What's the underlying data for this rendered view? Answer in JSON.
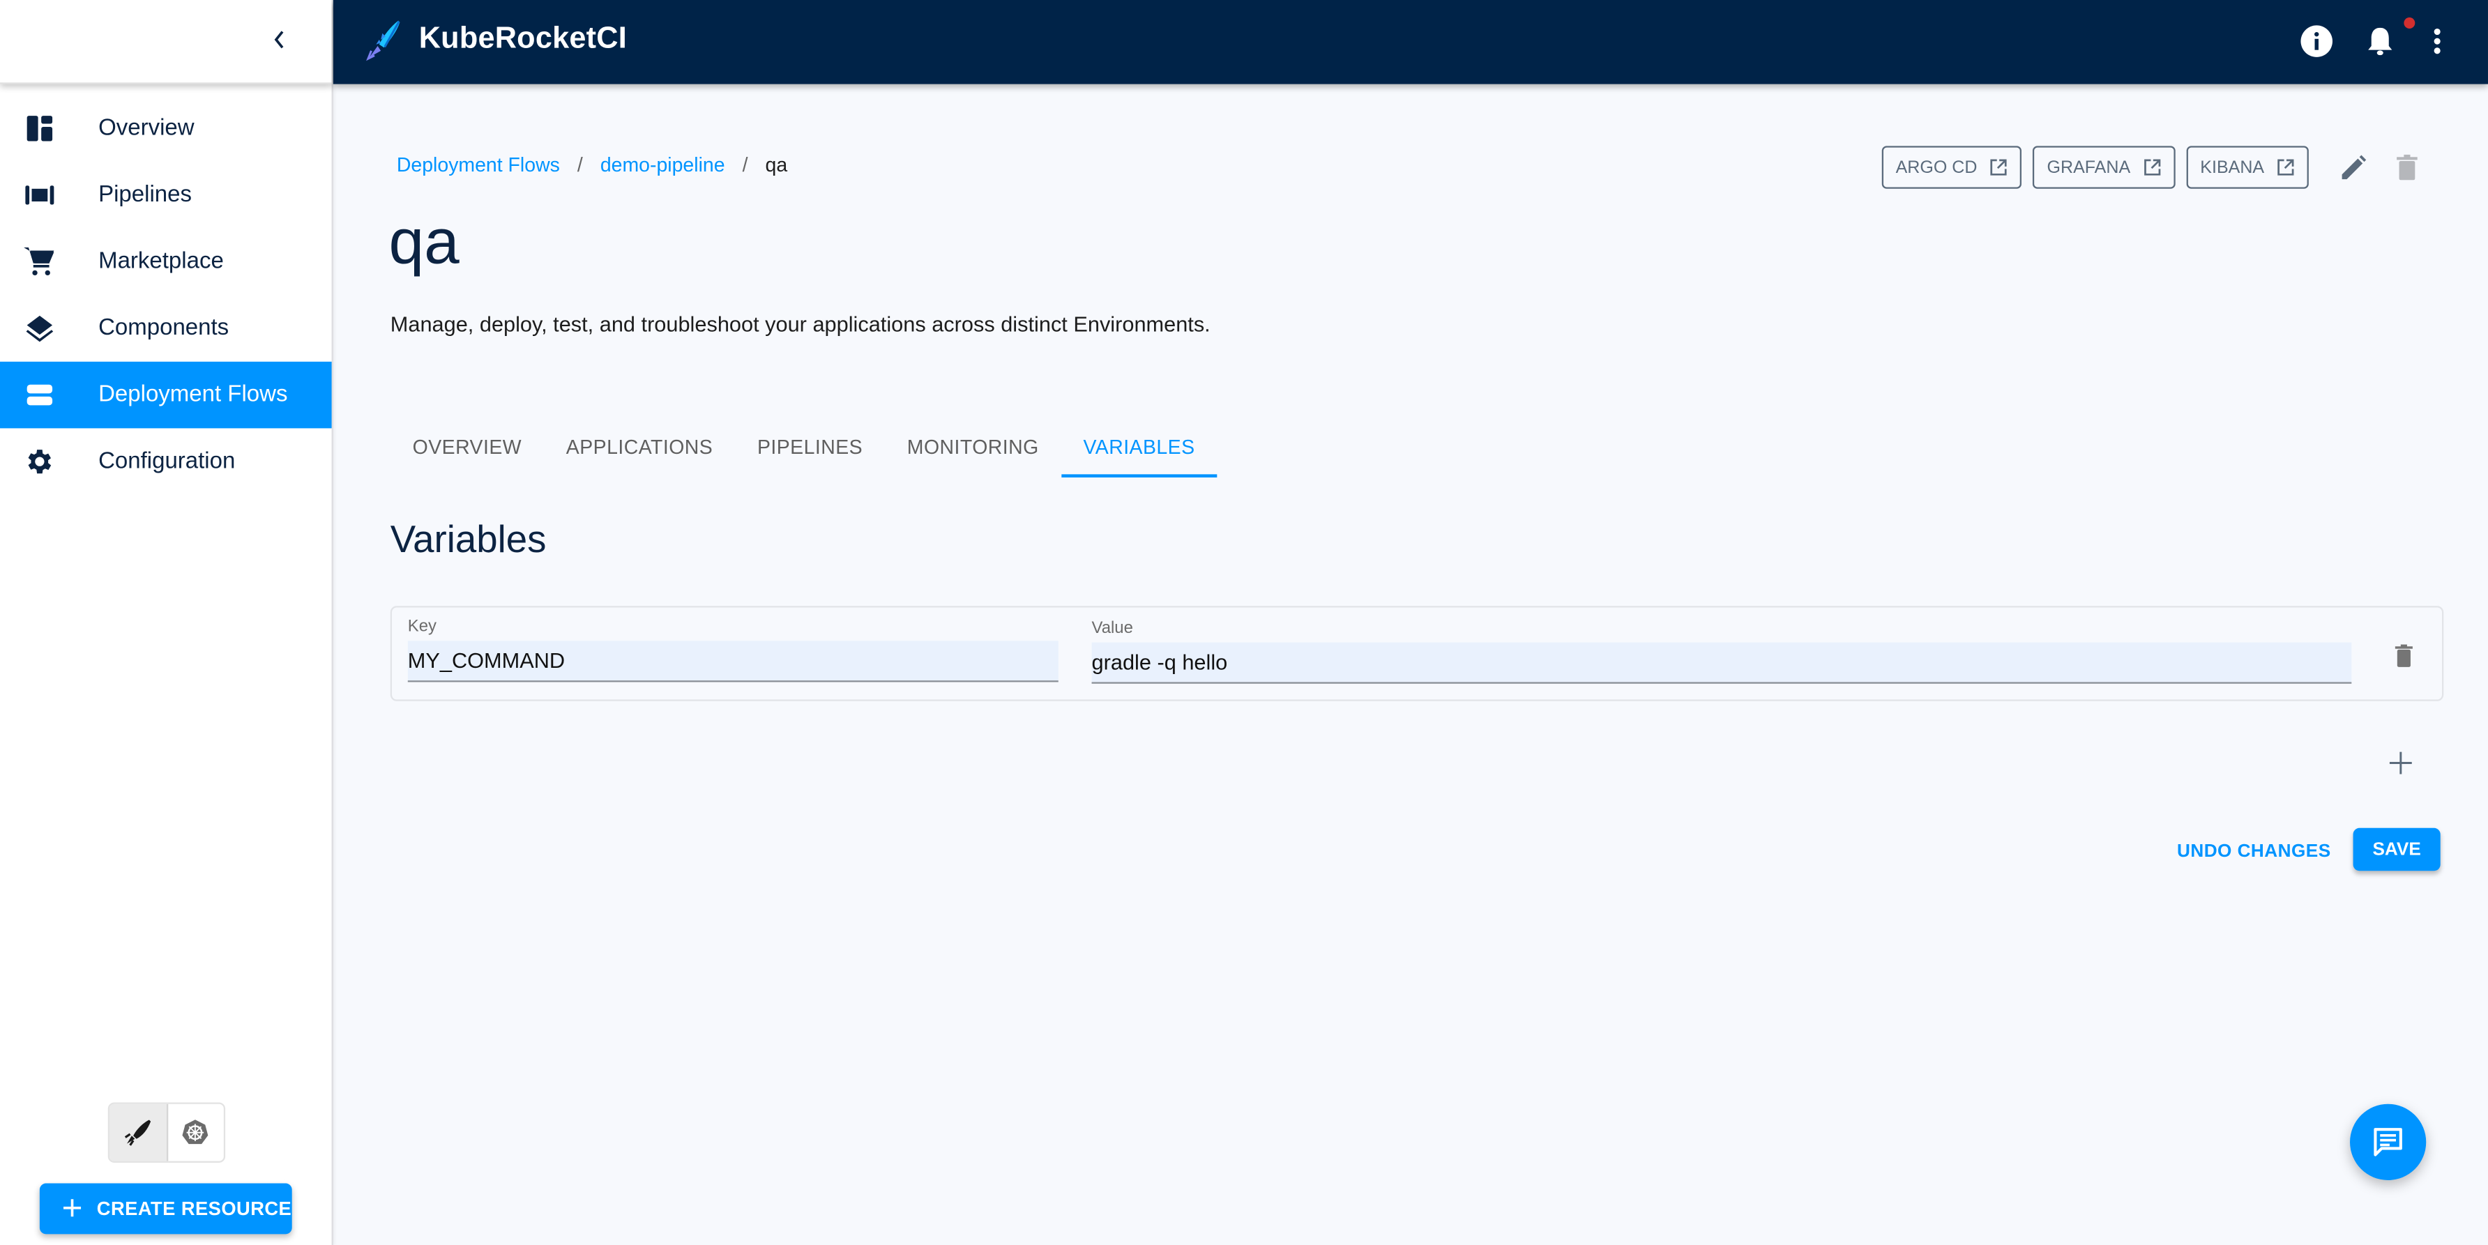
{
  "app": {
    "title": "KubeRocketCI"
  },
  "topbar": {
    "icons": [
      "info-icon",
      "notifications-icon",
      "more-vert-icon"
    ],
    "notification_badge": true
  },
  "sidebar": {
    "collapse_icon": "chevron-left-icon",
    "items": [
      {
        "label": "Overview",
        "icon": "dashboard-icon",
        "active": false
      },
      {
        "label": "Pipelines",
        "icon": "pipelines-icon",
        "active": false
      },
      {
        "label": "Marketplace",
        "icon": "cart-icon",
        "active": false
      },
      {
        "label": "Components",
        "icon": "layers-icon",
        "active": false
      },
      {
        "label": "Deployment Flows",
        "icon": "storage-icon",
        "active": true
      },
      {
        "label": "Configuration",
        "icon": "gear-icon",
        "active": false
      }
    ],
    "mode_toggle": [
      {
        "name": "kuberocketci-mode",
        "icon": "rocket-icon",
        "active": true
      },
      {
        "name": "kubernetes-mode",
        "icon": "kubernetes-helm-icon",
        "active": false
      }
    ],
    "create_button": "CREATE RESOURCE"
  },
  "breadcrumb": {
    "items": [
      "Deployment Flows",
      "demo-pipeline"
    ],
    "separator": "/",
    "current": "qa"
  },
  "page": {
    "title": "qa",
    "description": "Manage, deploy, test, and troubleshoot your applications across distinct Environments."
  },
  "actions": {
    "links": [
      "ARGO CD",
      "GRAFANA",
      "KIBANA"
    ],
    "edit_icon": "edit-icon",
    "delete_icon": "delete-icon"
  },
  "tabs": [
    {
      "label": "OVERVIEW",
      "active": false
    },
    {
      "label": "APPLICATIONS",
      "active": false
    },
    {
      "label": "PIPELINES",
      "active": false
    },
    {
      "label": "MONITORING",
      "active": false
    },
    {
      "label": "VARIABLES",
      "active": true
    }
  ],
  "variables": {
    "title": "Variables",
    "rows": [
      {
        "key_label": "Key",
        "key": "MY_COMMAND",
        "value_label": "Value",
        "value": "gradle -q hello"
      }
    ],
    "undo_label": "UNDO CHANGES",
    "save_label": "SAVE"
  },
  "colors": {
    "primary": "#0094FF",
    "topbar": "#002348",
    "text_dark": "#0C2342",
    "badge": "#D32F2F"
  }
}
